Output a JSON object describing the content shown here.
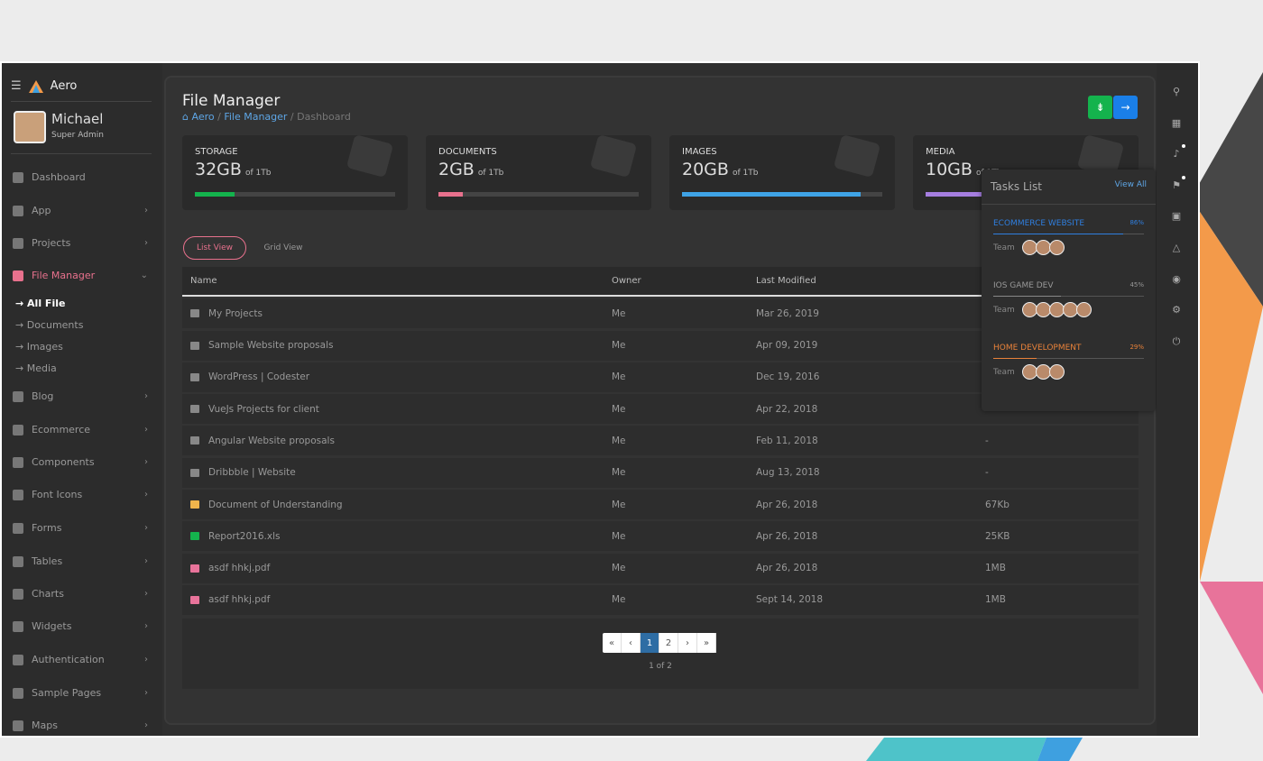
{
  "app": {
    "brand": "Aero"
  },
  "user": {
    "name": "Michael",
    "role": "Super Admin"
  },
  "sidebar": {
    "items": [
      {
        "label": "Dashboard",
        "icon": "home-icon",
        "chev": false
      },
      {
        "label": "App",
        "icon": "grid-icon",
        "chev": true
      },
      {
        "label": "Projects",
        "icon": "folder-icon",
        "chev": true
      },
      {
        "label": "File Manager",
        "icon": "folder-icon",
        "chev": true,
        "active": true
      },
      {
        "label": "Blog",
        "icon": "blog-icon",
        "chev": true
      },
      {
        "label": "Ecommerce",
        "icon": "cart-icon",
        "chev": true
      },
      {
        "label": "Components",
        "icon": "components-icon",
        "chev": true
      },
      {
        "label": "Font Icons",
        "icon": "gear-icon",
        "chev": true
      },
      {
        "label": "Forms",
        "icon": "form-icon",
        "chev": true
      },
      {
        "label": "Tables",
        "icon": "table-icon",
        "chev": true
      },
      {
        "label": "Charts",
        "icon": "chart-icon",
        "chev": true
      },
      {
        "label": "Widgets",
        "icon": "widgets-icon",
        "chev": true
      },
      {
        "label": "Authentication",
        "icon": "lock-icon",
        "chev": true
      },
      {
        "label": "Sample Pages",
        "icon": "pages-icon",
        "chev": true
      },
      {
        "label": "Maps",
        "icon": "map-icon",
        "chev": true
      }
    ],
    "subitems": [
      {
        "label": "All File",
        "active": true
      },
      {
        "label": "Documents"
      },
      {
        "label": "Images"
      },
      {
        "label": "Media"
      }
    ]
  },
  "header": {
    "title": "File Manager",
    "breadcrumb": [
      "Aero",
      "File Manager",
      "Dashboard"
    ]
  },
  "cards": [
    {
      "label": "STORAGE",
      "value": "32GB",
      "of": "of 1Tb",
      "progress": 20,
      "color": "#14b34d"
    },
    {
      "label": "DOCUMENTS",
      "value": "2GB",
      "of": "of 1Tb",
      "progress": 12,
      "color": "#e8718d"
    },
    {
      "label": "IMAGES",
      "value": "20GB",
      "of": "of 1Tb",
      "progress": 89,
      "color": "#3fa3e6"
    },
    {
      "label": "MEDIA",
      "value": "10GB",
      "of": "of 1Tb",
      "progress": 40,
      "color": "#a57ee0"
    }
  ],
  "tabs": [
    "List View",
    "Grid View"
  ],
  "table": {
    "headers": [
      "Name",
      "Owner",
      "Last Modified"
    ],
    "rows": [
      {
        "name": "My Projects",
        "type": "folder",
        "owner": "Me",
        "modified": "Mar 26, 2019",
        "size": "-"
      },
      {
        "name": "Sample Website proposals",
        "type": "folder",
        "owner": "Me",
        "modified": "Apr 09, 2019",
        "size": "-"
      },
      {
        "name": "WordPress | Codester",
        "type": "folder",
        "owner": "Me",
        "modified": "Dec 19, 2016",
        "size": "-"
      },
      {
        "name": "VueJs Projects for client",
        "type": "folder",
        "owner": "Me",
        "modified": "Apr 22, 2018",
        "size": "-"
      },
      {
        "name": "Angular Website proposals",
        "type": "folder",
        "owner": "Me",
        "modified": "Feb 11, 2018",
        "size": "-"
      },
      {
        "name": "Dribbble | Website",
        "type": "folder",
        "owner": "Me",
        "modified": "Aug 13, 2018",
        "size": "-"
      },
      {
        "name": "Document of Understanding",
        "type": "doc",
        "owner": "Me",
        "modified": "Apr 26, 2018",
        "size": "67Kb"
      },
      {
        "name": "Report2016.xls",
        "type": "xls",
        "owner": "Me",
        "modified": "Apr 26, 2018",
        "size": "25KB"
      },
      {
        "name": "asdf hhkj.pdf",
        "type": "pdf",
        "owner": "Me",
        "modified": "Apr 26, 2018",
        "size": "1MB"
      },
      {
        "name": "asdf hhkj.pdf",
        "type": "pdf",
        "owner": "Me",
        "modified": "Sept 14, 2018",
        "size": "1MB"
      }
    ]
  },
  "pagination": {
    "items": [
      "«",
      "‹",
      "1",
      "2",
      "›",
      "»"
    ],
    "current": "1",
    "summary": "1 of 2"
  },
  "tasks": {
    "title": "Tasks List",
    "view_all": "View All",
    "items": [
      {
        "name": "ECOMMERCE WEBSITE",
        "percent": "86%",
        "progress": 86,
        "color": "#2f7fe0",
        "team": "Team",
        "members": 3
      },
      {
        "name": "IOS GAME DEV",
        "percent": "45%",
        "progress": 45,
        "color": "#888888",
        "team": "Team",
        "members": 5
      },
      {
        "name": "HOME DEVELOPMENT",
        "percent": "29%",
        "progress": 29,
        "color": "#e8823a",
        "team": "Team",
        "members": 3
      }
    ]
  },
  "rightbar": [
    "search-icon",
    "apps-icon",
    "bell-icon",
    "flag-icon",
    "calendar-icon",
    "drive-icon",
    "palette-icon",
    "gear-icon",
    "power-icon"
  ],
  "colors": {
    "accent": "#e8718d",
    "link": "#5ea6e6",
    "green": "#14b34d",
    "blue": "#1a7fe8"
  }
}
